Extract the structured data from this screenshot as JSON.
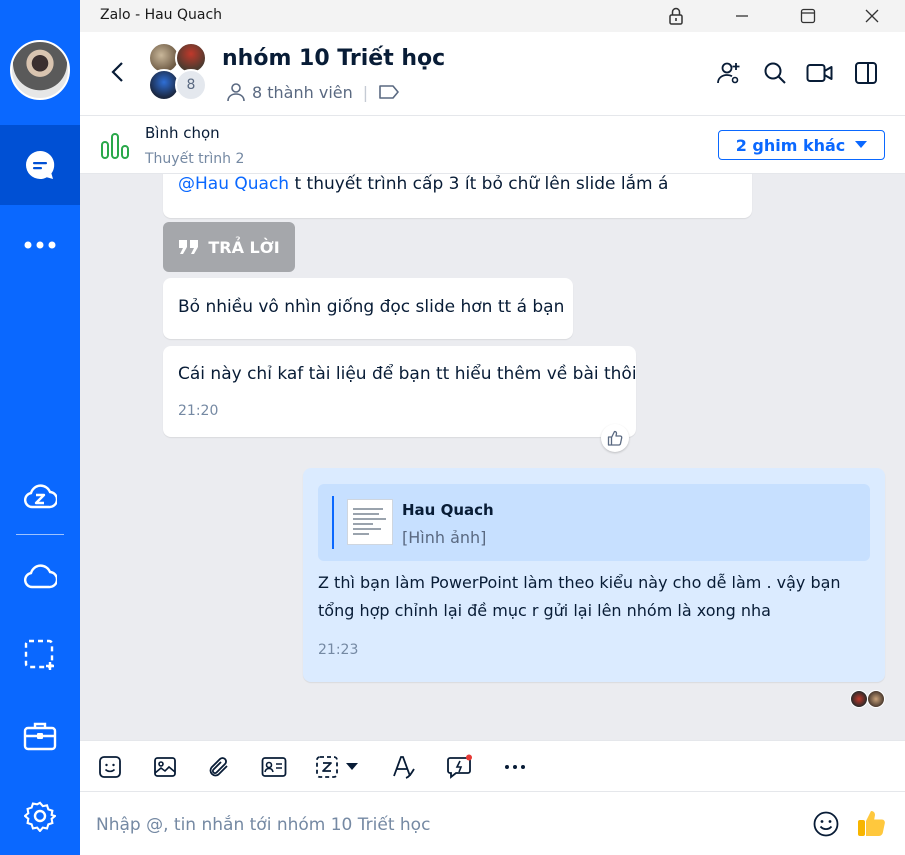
{
  "window": {
    "title": "Zalo - Hau Quach"
  },
  "header": {
    "group_name": "nhóm 10 Triết học",
    "member_count_badge": "8",
    "members_label": "8 thành viên"
  },
  "pinned": {
    "title": "Bình chọn",
    "subtitle": "Thuyết trình 2",
    "more_label": "2 ghim khác"
  },
  "messages": [
    {
      "mention": "@Hau Quach",
      "text": " t thuyết trình cấp 3 ít bỏ chữ lên slide lắm á"
    },
    {
      "reply_label": "TRẢ LỜI"
    },
    {
      "text": "Bỏ nhiều vô nhìn giống đọc slide hơn tt á bạn"
    },
    {
      "text": "Cái này chỉ kaf tài liệu để bạn tt hiểu thêm về bài thôi",
      "time": "21:20"
    }
  ],
  "my_message": {
    "quote_author": "Hau Quach",
    "quote_text": "[Hình ảnh]",
    "text_line1": "Z thì bạn làm PowerPoint  làm theo kiểu này cho dễ làm . vậy bạn",
    "text_line2": "tổng hợp chỉnh lại đề mục r gửi lại lên nhóm là xong nha",
    "time": "21:23"
  },
  "composer": {
    "placeholder": "Nhập @, tin nhắn tới nhóm 10 Triết học"
  },
  "colors": {
    "brand": "#0a68ff",
    "chat_bg": "#ebecf0",
    "my_bubble": "#dbebff"
  }
}
